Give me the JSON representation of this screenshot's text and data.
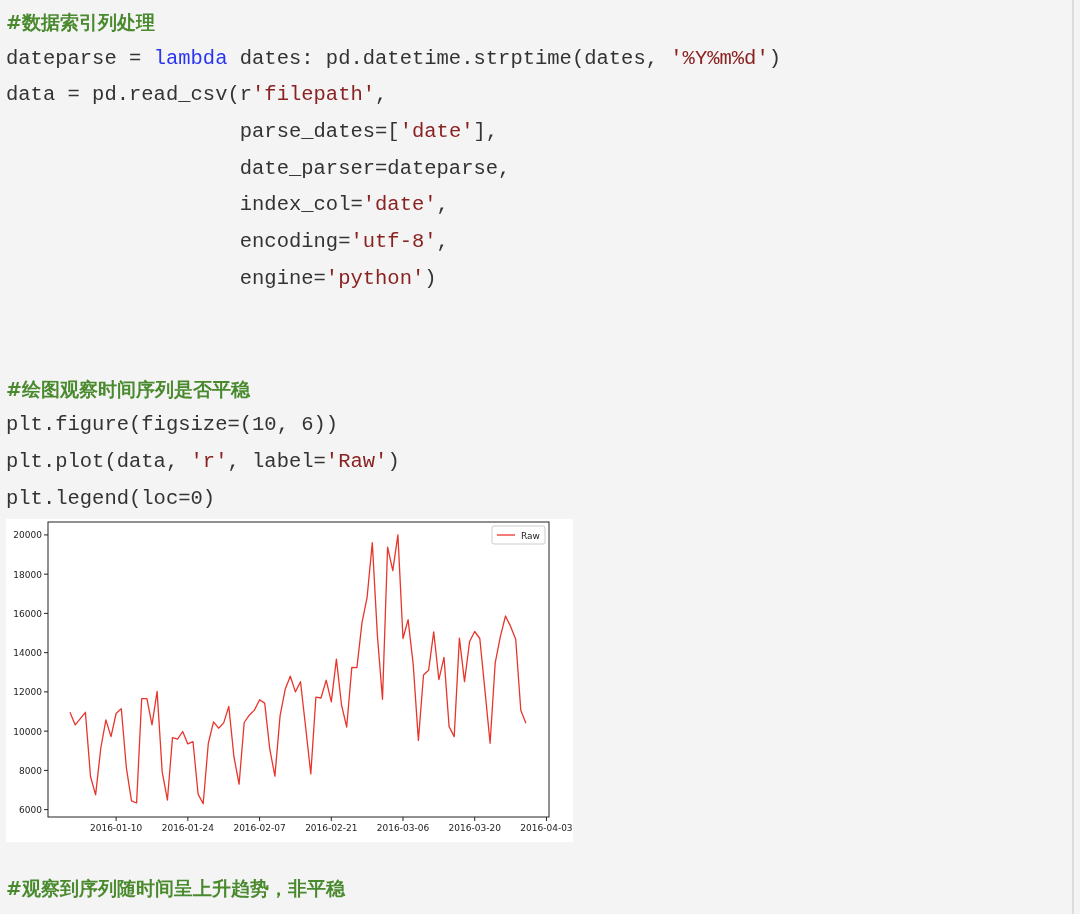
{
  "cells": [
    {
      "lines": [
        {
          "kind": "comment",
          "text": "#数据索引列处理"
        },
        {
          "kind": "code",
          "segments": [
            {
              "kind": "plain",
              "text": "dateparse = "
            },
            {
              "kind": "keyword",
              "text": "lambda"
            },
            {
              "kind": "plain",
              "text": " dates: pd.datetime.strptime(dates, "
            },
            {
              "kind": "string",
              "text": "'%Y%m%d'"
            },
            {
              "kind": "plain",
              "text": ")"
            }
          ]
        },
        {
          "kind": "code",
          "segments": [
            {
              "kind": "plain",
              "text": "data = pd.read_csv(r"
            },
            {
              "kind": "string",
              "text": "'filepath'"
            },
            {
              "kind": "plain",
              "text": ","
            }
          ]
        },
        {
          "kind": "code",
          "segments": [
            {
              "kind": "plain",
              "text": "                   parse_dates=["
            },
            {
              "kind": "string",
              "text": "'date'"
            },
            {
              "kind": "plain",
              "text": "],"
            }
          ]
        },
        {
          "kind": "code",
          "segments": [
            {
              "kind": "plain",
              "text": "                   date_parser=dateparse,"
            }
          ]
        },
        {
          "kind": "code",
          "segments": [
            {
              "kind": "plain",
              "text": "                   index_col="
            },
            {
              "kind": "string",
              "text": "'date'"
            },
            {
              "kind": "plain",
              "text": ","
            }
          ]
        },
        {
          "kind": "code",
          "segments": [
            {
              "kind": "plain",
              "text": "                   encoding="
            },
            {
              "kind": "string",
              "text": "'utf-8'"
            },
            {
              "kind": "plain",
              "text": ","
            }
          ]
        },
        {
          "kind": "code",
          "segments": [
            {
              "kind": "plain",
              "text": "                   engine="
            },
            {
              "kind": "string",
              "text": "'python'"
            },
            {
              "kind": "plain",
              "text": ")"
            }
          ]
        }
      ]
    },
    {
      "lines": [
        {
          "kind": "comment",
          "text": "#绘图观察时间序列是否平稳"
        },
        {
          "kind": "code",
          "segments": [
            {
              "kind": "plain",
              "text": "plt.figure(figsize=(10, 6))"
            }
          ]
        },
        {
          "kind": "code",
          "segments": [
            {
              "kind": "plain",
              "text": "plt.plot(data, "
            },
            {
              "kind": "string",
              "text": "'r'"
            },
            {
              "kind": "plain",
              "text": ", label="
            },
            {
              "kind": "string",
              "text": "'Raw'"
            },
            {
              "kind": "plain",
              "text": ")"
            }
          ]
        },
        {
          "kind": "code",
          "segments": [
            {
              "kind": "plain",
              "text": "plt.legend(loc=0)"
            }
          ]
        }
      ],
      "chart_data": {
        "type": "line",
        "categories": [
          null,
          null,
          null,
          null,
          null,
          null,
          null,
          null,
          null,
          "2016-01-10",
          null,
          null,
          null,
          null,
          null,
          null,
          null,
          null,
          null,
          null,
          null,
          null,
          null,
          "2016-01-24",
          null,
          null,
          null,
          null,
          null,
          null,
          null,
          null,
          null,
          null,
          null,
          null,
          null,
          "2016-02-07",
          null,
          null,
          null,
          null,
          null,
          null,
          null,
          null,
          null,
          null,
          null,
          null,
          null,
          "2016-02-21",
          null,
          null,
          null,
          null,
          null,
          null,
          null,
          null,
          null,
          null,
          null,
          null,
          null,
          "2016-03-06",
          null,
          null,
          null,
          null,
          null,
          null,
          null,
          null,
          null,
          null,
          null,
          null,
          null,
          "2016-03-20",
          null,
          null,
          null,
          null,
          null,
          null,
          null,
          null,
          null,
          null,
          null,
          null,
          null,
          "2016-04-03"
        ],
        "series": [
          {
            "name": "Raw",
            "color": "#e8352b",
            "values": [
              10960,
              10320,
              10640,
              10960,
              7690,
              6750,
              9140,
              10570,
              9720,
              10900,
              11150,
              8110,
              6450,
              6340,
              11660,
              11660,
              10320,
              12030,
              7920,
              6490,
              9670,
              9590,
              9980,
              9350,
              9460,
              6790,
              6300,
              9370,
              10470,
              10150,
              10420,
              11260,
              8670,
              7300,
              10440,
              10810,
              11070,
              11600,
              11430,
              9080,
              7710,
              10790,
              12130,
              12800,
              12000,
              12520,
              10170,
              7820,
              11730,
              11690,
              12600,
              11490,
              13670,
              11340,
              10210,
              13250,
              13240,
              15530,
              16820,
              19610,
              14870,
              11620,
              19380,
              18180,
              20000,
              14720,
              15680,
              13400,
              9530,
              12860,
              13100,
              15060,
              12620,
              13760,
              10230,
              9720,
              14740,
              12520,
              14570,
              15080,
              14720,
              12050,
              9380,
              13480,
              14810,
              15870,
              15340,
              14680,
              11060,
              10400,
              null,
              null,
              null,
              null
            ]
          }
        ],
        "ylim": [
          5624,
          20658
        ],
        "yticks": [
          6000,
          8000,
          10000,
          12000,
          14000,
          16000,
          18000,
          20000
        ]
      }
    },
    {
      "lines": [
        {
          "kind": "comment",
          "text": "#观察到序列随时间呈上升趋势，非平稳"
        }
      ]
    }
  ]
}
